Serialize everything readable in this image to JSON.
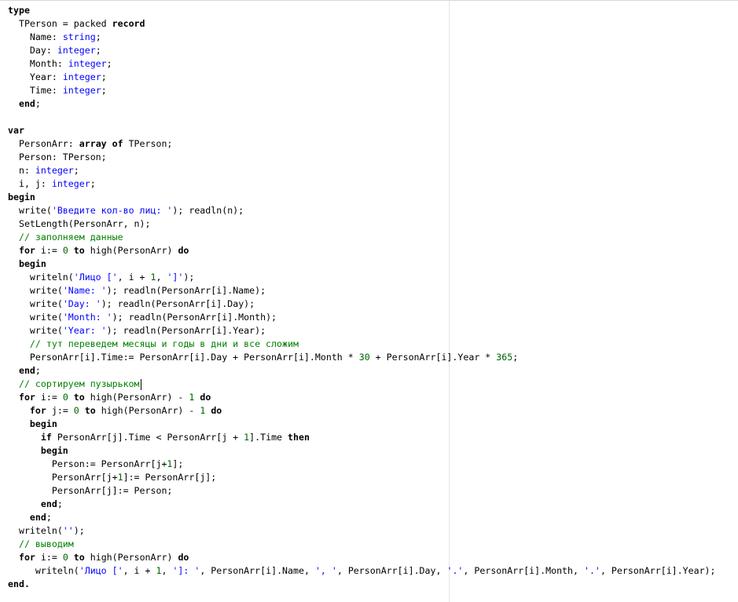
{
  "colors": {
    "keyword": "#000000",
    "type": "#0000ff",
    "string": "#0000ff",
    "number": "#006400",
    "comment": "#008000",
    "identifier": "#000000"
  },
  "code_lines": [
    [
      {
        "t": "kw",
        "v": "type"
      }
    ],
    [
      {
        "t": "id",
        "v": "  TPerson = packed "
      },
      {
        "t": "kw",
        "v": "record"
      }
    ],
    [
      {
        "t": "id",
        "v": "    Name: "
      },
      {
        "t": "ty",
        "v": "string"
      },
      {
        "t": "id",
        "v": ";"
      }
    ],
    [
      {
        "t": "id",
        "v": "    Day: "
      },
      {
        "t": "ty",
        "v": "integer"
      },
      {
        "t": "id",
        "v": ";"
      }
    ],
    [
      {
        "t": "id",
        "v": "    Month: "
      },
      {
        "t": "ty",
        "v": "integer"
      },
      {
        "t": "id",
        "v": ";"
      }
    ],
    [
      {
        "t": "id",
        "v": "    Year: "
      },
      {
        "t": "ty",
        "v": "integer"
      },
      {
        "t": "id",
        "v": ";"
      }
    ],
    [
      {
        "t": "id",
        "v": "    Time: "
      },
      {
        "t": "ty",
        "v": "integer"
      },
      {
        "t": "id",
        "v": ";"
      }
    ],
    [
      {
        "t": "id",
        "v": "  "
      },
      {
        "t": "kw",
        "v": "end"
      },
      {
        "t": "id",
        "v": ";"
      }
    ],
    [],
    [
      {
        "t": "kw",
        "v": "var"
      }
    ],
    [
      {
        "t": "id",
        "v": "  PersonArr: "
      },
      {
        "t": "kw",
        "v": "array of"
      },
      {
        "t": "id",
        "v": " TPerson;"
      }
    ],
    [
      {
        "t": "id",
        "v": "  Person: TPerson;"
      }
    ],
    [
      {
        "t": "id",
        "v": "  n: "
      },
      {
        "t": "ty",
        "v": "integer"
      },
      {
        "t": "id",
        "v": ";"
      }
    ],
    [
      {
        "t": "id",
        "v": "  i, j: "
      },
      {
        "t": "ty",
        "v": "integer"
      },
      {
        "t": "id",
        "v": ";"
      }
    ],
    [
      {
        "t": "kw",
        "v": "begin"
      }
    ],
    [
      {
        "t": "id",
        "v": "  write("
      },
      {
        "t": "st",
        "v": "'Введите кол-во лиц: '"
      },
      {
        "t": "id",
        "v": "); readln(n);"
      }
    ],
    [
      {
        "t": "id",
        "v": "  SetLength(PersonArr, n);"
      }
    ],
    [
      {
        "t": "cm",
        "v": "  // заполняем данные"
      }
    ],
    [
      {
        "t": "id",
        "v": "  "
      },
      {
        "t": "kw",
        "v": "for"
      },
      {
        "t": "id",
        "v": " i:= "
      },
      {
        "t": "nu",
        "v": "0"
      },
      {
        "t": "id",
        "v": " "
      },
      {
        "t": "kw",
        "v": "to"
      },
      {
        "t": "id",
        "v": " high(PersonArr) "
      },
      {
        "t": "kw",
        "v": "do"
      }
    ],
    [
      {
        "t": "id",
        "v": "  "
      },
      {
        "t": "kw",
        "v": "begin"
      }
    ],
    [
      {
        "t": "id",
        "v": "    writeln("
      },
      {
        "t": "st",
        "v": "'Лицо ['"
      },
      {
        "t": "id",
        "v": ", i + "
      },
      {
        "t": "nu",
        "v": "1"
      },
      {
        "t": "id",
        "v": ", "
      },
      {
        "t": "st",
        "v": "']'"
      },
      {
        "t": "id",
        "v": ");"
      }
    ],
    [
      {
        "t": "id",
        "v": "    write("
      },
      {
        "t": "st",
        "v": "'Name: '"
      },
      {
        "t": "id",
        "v": "); readln(PersonArr[i].Name);"
      }
    ],
    [
      {
        "t": "id",
        "v": "    write("
      },
      {
        "t": "st",
        "v": "'Day: '"
      },
      {
        "t": "id",
        "v": "); readln(PersonArr[i].Day);"
      }
    ],
    [
      {
        "t": "id",
        "v": "    write("
      },
      {
        "t": "st",
        "v": "'Month: '"
      },
      {
        "t": "id",
        "v": "); readln(PersonArr[i].Month);"
      }
    ],
    [
      {
        "t": "id",
        "v": "    write("
      },
      {
        "t": "st",
        "v": "'Year: '"
      },
      {
        "t": "id",
        "v": "); readln(PersonArr[i].Year);"
      }
    ],
    [
      {
        "t": "cm",
        "v": "    // тут переведем месяцы и годы в дни и все сложим"
      }
    ],
    [
      {
        "t": "id",
        "v": "    PersonArr[i].Time:= PersonArr[i].Day + PersonArr[i].Month * "
      },
      {
        "t": "nu",
        "v": "30"
      },
      {
        "t": "id",
        "v": " + PersonArr[i].Year * "
      },
      {
        "t": "nu",
        "v": "365"
      },
      {
        "t": "id",
        "v": ";"
      }
    ],
    [
      {
        "t": "id",
        "v": "  "
      },
      {
        "t": "kw",
        "v": "end"
      },
      {
        "t": "id",
        "v": ";"
      }
    ],
    [
      {
        "t": "cm",
        "v": "  // сортируем пузырьком"
      },
      {
        "t": "caret",
        "v": ""
      }
    ],
    [
      {
        "t": "id",
        "v": "  "
      },
      {
        "t": "kw",
        "v": "for"
      },
      {
        "t": "id",
        "v": " i:= "
      },
      {
        "t": "nu",
        "v": "0"
      },
      {
        "t": "id",
        "v": " "
      },
      {
        "t": "kw",
        "v": "to"
      },
      {
        "t": "id",
        "v": " high(PersonArr) - "
      },
      {
        "t": "nu",
        "v": "1"
      },
      {
        "t": "id",
        "v": " "
      },
      {
        "t": "kw",
        "v": "do"
      }
    ],
    [
      {
        "t": "id",
        "v": "    "
      },
      {
        "t": "kw",
        "v": "for"
      },
      {
        "t": "id",
        "v": " j:= "
      },
      {
        "t": "nu",
        "v": "0"
      },
      {
        "t": "id",
        "v": " "
      },
      {
        "t": "kw",
        "v": "to"
      },
      {
        "t": "id",
        "v": " high(PersonArr) - "
      },
      {
        "t": "nu",
        "v": "1"
      },
      {
        "t": "id",
        "v": " "
      },
      {
        "t": "kw",
        "v": "do"
      }
    ],
    [
      {
        "t": "id",
        "v": "    "
      },
      {
        "t": "kw",
        "v": "begin"
      }
    ],
    [
      {
        "t": "id",
        "v": "      "
      },
      {
        "t": "kw",
        "v": "if"
      },
      {
        "t": "id",
        "v": " PersonArr[j].Time < PersonArr[j + "
      },
      {
        "t": "nu",
        "v": "1"
      },
      {
        "t": "id",
        "v": "].Time "
      },
      {
        "t": "kw",
        "v": "then"
      }
    ],
    [
      {
        "t": "id",
        "v": "      "
      },
      {
        "t": "kw",
        "v": "begin"
      }
    ],
    [
      {
        "t": "id",
        "v": "        Person:= PersonArr[j+"
      },
      {
        "t": "nu",
        "v": "1"
      },
      {
        "t": "id",
        "v": "];"
      }
    ],
    [
      {
        "t": "id",
        "v": "        PersonArr[j+"
      },
      {
        "t": "nu",
        "v": "1"
      },
      {
        "t": "id",
        "v": "]:= PersonArr[j];"
      }
    ],
    [
      {
        "t": "id",
        "v": "        PersonArr[j]:= Person;"
      }
    ],
    [
      {
        "t": "id",
        "v": "      "
      },
      {
        "t": "kw",
        "v": "end"
      },
      {
        "t": "id",
        "v": ";"
      }
    ],
    [
      {
        "t": "id",
        "v": "    "
      },
      {
        "t": "kw",
        "v": "end"
      },
      {
        "t": "id",
        "v": ";"
      }
    ],
    [
      {
        "t": "id",
        "v": "  writeln("
      },
      {
        "t": "st",
        "v": "''"
      },
      {
        "t": "id",
        "v": ");"
      }
    ],
    [
      {
        "t": "cm",
        "v": "  // выводим"
      }
    ],
    [
      {
        "t": "id",
        "v": "  "
      },
      {
        "t": "kw",
        "v": "for"
      },
      {
        "t": "id",
        "v": " i:= "
      },
      {
        "t": "nu",
        "v": "0"
      },
      {
        "t": "id",
        "v": " "
      },
      {
        "t": "kw",
        "v": "to"
      },
      {
        "t": "id",
        "v": " high(PersonArr) "
      },
      {
        "t": "kw",
        "v": "do"
      }
    ],
    [
      {
        "t": "id",
        "v": "     writeln("
      },
      {
        "t": "st",
        "v": "'Лицо ['"
      },
      {
        "t": "id",
        "v": ", i + "
      },
      {
        "t": "nu",
        "v": "1"
      },
      {
        "t": "id",
        "v": ", "
      },
      {
        "t": "st",
        "v": "']: '"
      },
      {
        "t": "id",
        "v": ", PersonArr[i].Name, "
      },
      {
        "t": "st",
        "v": "', '"
      },
      {
        "t": "id",
        "v": ", PersonArr[i].Day, "
      },
      {
        "t": "st",
        "v": "'.'"
      },
      {
        "t": "id",
        "v": ", PersonArr[i].Month, "
      },
      {
        "t": "st",
        "v": "'.'"
      },
      {
        "t": "id",
        "v": ", PersonArr[i].Year);"
      }
    ],
    [
      {
        "t": "kw",
        "v": "end."
      }
    ]
  ]
}
